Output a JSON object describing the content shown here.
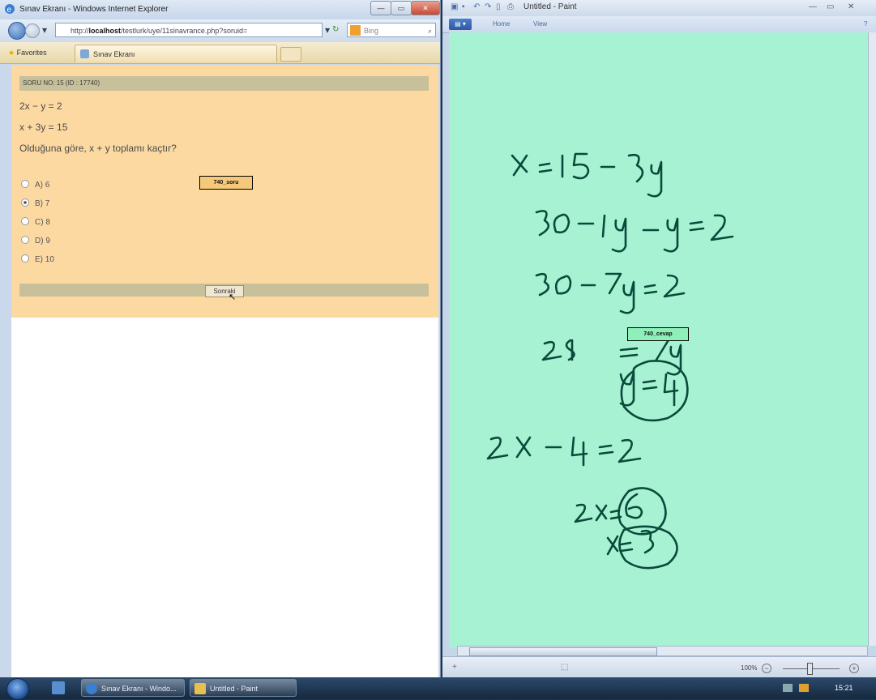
{
  "ie": {
    "title": "Sınav Ekranı - Windows Internet Explorer",
    "address_prefix": "http://",
    "address_host": "localhost",
    "address_rest": "/testlurk/uye/11sinavrance.php?soruid=",
    "search_placeholder": "Bing",
    "favorites_label": "Favorites",
    "tab_label": "Sınav Ekranı",
    "soru_header": "SORU NO: 15 (ID : 17740)",
    "question_line1": "2x − y = 2",
    "question_line2": "x + 3y = 15",
    "question_prompt": "Olduğuna göre, x + y toplamı kaçtır?",
    "options": [
      {
        "label": "A) 6",
        "selected": false
      },
      {
        "label": "B) 7",
        "selected": true
      },
      {
        "label": "C) 8",
        "selected": false
      },
      {
        "label": "D) 9",
        "selected": false
      },
      {
        "label": "E) 10",
        "selected": false
      }
    ],
    "tag_soru": "740_soru",
    "next_button": "Sonraki"
  },
  "paint": {
    "title": "Untitled - Paint",
    "tab_home": "Home",
    "tab_view": "View",
    "tag_cevap": "740_cevap",
    "zoom": "100%"
  },
  "taskbar": {
    "task_ie": "Sınav Ekranı - Windo...",
    "task_paint": "Untitled - Paint",
    "clock": "15:21"
  },
  "colors": {
    "exam_bg": "#fdd9a2",
    "canvas_bg": "#a8f2d4",
    "ink": "#0a4a3a"
  }
}
